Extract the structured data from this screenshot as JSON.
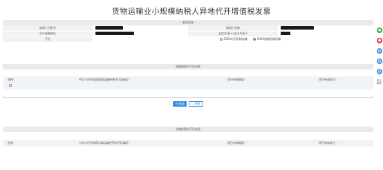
{
  "page_title": "货物运输业小规模纳税人异地代开增值税发票",
  "basic_info": {
    "header": "基本信息",
    "taxpayer_id_label": "纳税人识别号",
    "taxpayer_name_label": "纳税人名称",
    "business_address_label": "生产经营地址",
    "legal_rep_label": "法定(负责人)业主代表人",
    "industry_label": "行业",
    "industry_options": [
      {
        "label": "5523内河货物运输",
        "checked": false
      },
      {
        "label": "5430道路货物运输",
        "checked": true
      }
    ]
  },
  "road_permit": {
    "header": "道路经营许可证信息",
    "columns": {
      "select": "选择",
      "permit_no": "中华人民共和国道路运输经营许可证编号",
      "valid_from": "项目有效期起",
      "valid_to": "项目有效期止"
    },
    "required_mark": "*",
    "add_button": "添加",
    "delete_button": "删除"
  },
  "water_permit": {
    "header": "水路经营许可证信息",
    "columns": {
      "select": "选择",
      "permit_no": "中华人民共和国水路运输经营许可证编号",
      "valid_from": "项目有效期起",
      "valid_to": "项目有效期止"
    }
  },
  "side_toolbar": {
    "icons": [
      {
        "name": "wechat-icon",
        "color": "#2fa84f",
        "glyph": "●"
      },
      {
        "name": "weibo-icon",
        "color": "#e0373d",
        "glyph": "●"
      },
      {
        "name": "doc-icon-1",
        "color": "#3a94e0",
        "glyph": "▤"
      },
      {
        "name": "doc-icon-2",
        "color": "#3a94e0",
        "glyph": "▤"
      },
      {
        "name": "doc-icon-3",
        "color": "#3a94e0",
        "glyph": "▤"
      }
    ],
    "bottom_text": "网上服务"
  },
  "colors": {
    "accent": "#3a94e0",
    "section_bg": "#eaeaea",
    "label_bg": "#f2f2f2",
    "required": "#e05a5a"
  }
}
